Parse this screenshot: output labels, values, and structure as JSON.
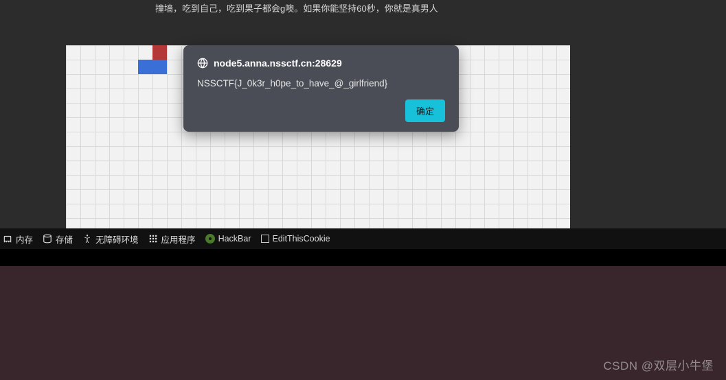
{
  "instruction": "撞墙，吃到自己，吃到果子都会g噢。如果你能坚持60秒，你就是真男人",
  "dialog": {
    "host": "node5.anna.nssctf.cn:28629",
    "message": "NSSCTF{J_0k3r_h0pe_to_have_@_girlfriend}",
    "ok_label": "确定"
  },
  "toolbar": {
    "memory": "内存",
    "storage": "存储",
    "a11y": "无障碍环境",
    "apps": "应用程序",
    "hackbar": "HackBar",
    "editcookie": "EditThisCookie"
  },
  "watermark": "CSDN @双层小牛堡"
}
